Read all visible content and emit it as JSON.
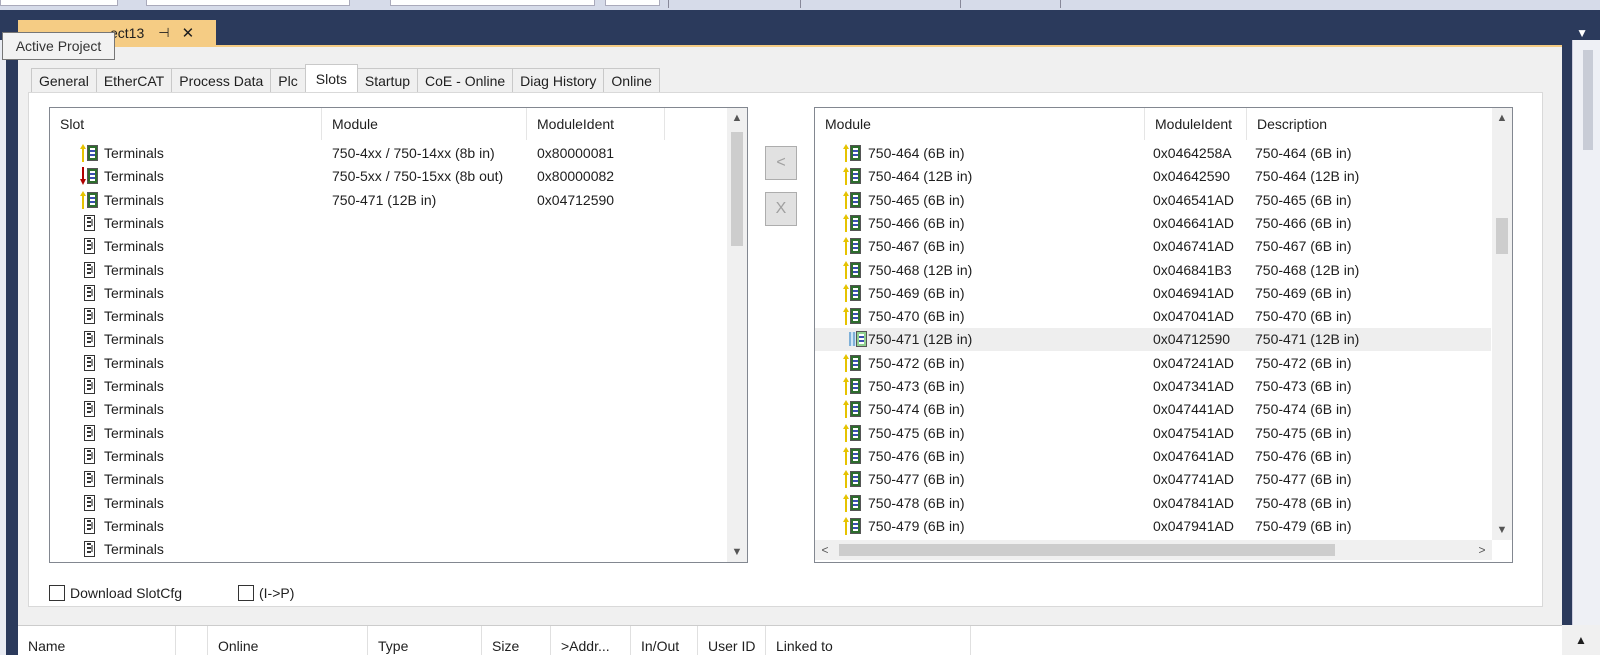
{
  "document": {
    "tab_title": "ect13",
    "tooltip": "Active Project",
    "pin_glyph": "⊣",
    "close_glyph": "✕",
    "window_menu_glyph": "▼"
  },
  "tabs": [
    "General",
    "EtherCAT",
    "Process Data",
    "Plc",
    "Slots",
    "Startup",
    "CoE - Online",
    "Diag History",
    "Online"
  ],
  "active_tab": "Slots",
  "slots_table": {
    "columns": [
      "Slot",
      "Module",
      "ModuleIdent"
    ],
    "rows": [
      {
        "slot": "Terminals",
        "module": "750-4xx / 750-14xx (8b in)",
        "ident": "0x80000081",
        "icon": "input-module-icon"
      },
      {
        "slot": "Terminals",
        "module": "750-5xx / 750-15xx (8b out)",
        "ident": "0x80000082",
        "icon": "output-module-icon"
      },
      {
        "slot": "Terminals",
        "module": "750-471 (12B in)",
        "ident": "0x04712590",
        "icon": "input-module-icon"
      },
      {
        "slot": "Terminals",
        "module": "",
        "ident": "",
        "icon": "empty-terminal-icon"
      },
      {
        "slot": "Terminals",
        "module": "",
        "ident": "",
        "icon": "empty-terminal-icon"
      },
      {
        "slot": "Terminals",
        "module": "",
        "ident": "",
        "icon": "empty-terminal-icon"
      },
      {
        "slot": "Terminals",
        "module": "",
        "ident": "",
        "icon": "empty-terminal-icon"
      },
      {
        "slot": "Terminals",
        "module": "",
        "ident": "",
        "icon": "empty-terminal-icon"
      },
      {
        "slot": "Terminals",
        "module": "",
        "ident": "",
        "icon": "empty-terminal-icon"
      },
      {
        "slot": "Terminals",
        "module": "",
        "ident": "",
        "icon": "empty-terminal-icon"
      },
      {
        "slot": "Terminals",
        "module": "",
        "ident": "",
        "icon": "empty-terminal-icon"
      },
      {
        "slot": "Terminals",
        "module": "",
        "ident": "",
        "icon": "empty-terminal-icon"
      },
      {
        "slot": "Terminals",
        "module": "",
        "ident": "",
        "icon": "empty-terminal-icon"
      },
      {
        "slot": "Terminals",
        "module": "",
        "ident": "",
        "icon": "empty-terminal-icon"
      },
      {
        "slot": "Terminals",
        "module": "",
        "ident": "",
        "icon": "empty-terminal-icon"
      },
      {
        "slot": "Terminals",
        "module": "",
        "ident": "",
        "icon": "empty-terminal-icon"
      },
      {
        "slot": "Terminals",
        "module": "",
        "ident": "",
        "icon": "empty-terminal-icon"
      },
      {
        "slot": "Terminals",
        "module": "",
        "ident": "",
        "icon": "empty-terminal-icon"
      }
    ]
  },
  "buttons": {
    "insert_label": "<",
    "remove_label": "X"
  },
  "modules_table": {
    "columns": [
      "Module",
      "ModuleIdent",
      "Description"
    ],
    "rows": [
      {
        "module": "750-464 (6B in)",
        "ident": "0x0464258A",
        "desc": "750-464 (6B in)"
      },
      {
        "module": "750-464 (12B in)",
        "ident": "0x04642590",
        "desc": "750-464 (12B in)"
      },
      {
        "module": "750-465 (6B in)",
        "ident": "0x046541AD",
        "desc": "750-465 (6B in)"
      },
      {
        "module": "750-466 (6B in)",
        "ident": "0x046641AD",
        "desc": "750-466 (6B in)"
      },
      {
        "module": "750-467 (6B in)",
        "ident": "0x046741AD",
        "desc": "750-467 (6B in)"
      },
      {
        "module": "750-468 (12B in)",
        "ident": "0x046841B3",
        "desc": "750-468 (12B in)"
      },
      {
        "module": "750-469 (6B in)",
        "ident": "0x046941AD",
        "desc": "750-469 (6B in)"
      },
      {
        "module": "750-470 (6B in)",
        "ident": "0x047041AD",
        "desc": "750-470 (6B in)"
      },
      {
        "module": "750-471 (12B in)",
        "ident": "0x04712590",
        "desc": "750-471 (12B in)",
        "selected": true
      },
      {
        "module": "750-472 (6B in)",
        "ident": "0x047241AD",
        "desc": "750-472 (6B in)"
      },
      {
        "module": "750-473 (6B in)",
        "ident": "0x047341AD",
        "desc": "750-473 (6B in)"
      },
      {
        "module": "750-474 (6B in)",
        "ident": "0x047441AD",
        "desc": "750-474 (6B in)"
      },
      {
        "module": "750-475 (6B in)",
        "ident": "0x047541AD",
        "desc": "750-475 (6B in)"
      },
      {
        "module": "750-476 (6B in)",
        "ident": "0x047641AD",
        "desc": "750-476 (6B in)"
      },
      {
        "module": "750-477 (6B in)",
        "ident": "0x047741AD",
        "desc": "750-477 (6B in)"
      },
      {
        "module": "750-478 (6B in)",
        "ident": "0x047841AD",
        "desc": "750-478 (6B in)"
      },
      {
        "module": "750-479 (6B in)",
        "ident": "0x047941AD",
        "desc": "750-479 (6B in)"
      }
    ]
  },
  "checkboxes": {
    "download_slotcfg": "Download SlotCfg",
    "i_to_p": "(I->P)"
  },
  "bottom_columns": [
    "Name",
    "",
    "Online",
    "Type",
    "Size",
    ">Addr...",
    "In/Out",
    "User ID",
    "Linked to"
  ],
  "scroll_glyphs": {
    "up": "▲",
    "down": "▼",
    "left": "<",
    "right": ">"
  },
  "colors": {
    "accent_tab": "#f5cc84",
    "frame": "#2b3a5c",
    "selection": "#eeeeee"
  }
}
